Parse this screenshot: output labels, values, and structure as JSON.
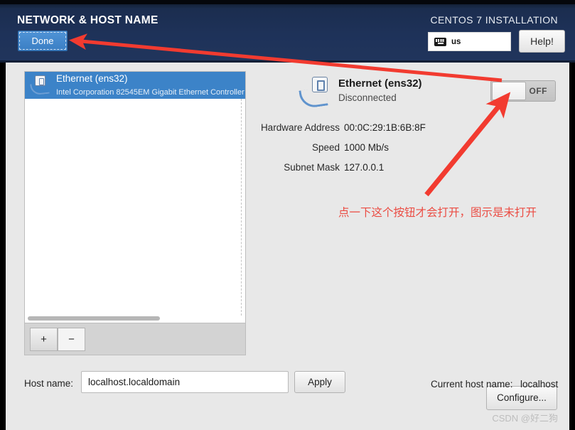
{
  "header": {
    "page_title": "NETWORK & HOST NAME",
    "done_label": "Done",
    "install_title": "CENTOS 7 INSTALLATION",
    "keyboard_layout": "us",
    "help_label": "Help!"
  },
  "device_list": {
    "items": [
      {
        "name": "Ethernet (ens32)",
        "description": "Intel Corporation 82545EM Gigabit Ethernet Controller (",
        "selected": true,
        "icon": "ethernet-icon"
      }
    ],
    "add_label": "+",
    "remove_label": "−"
  },
  "detail": {
    "icon": "ethernet-icon",
    "name": "Ethernet (ens32)",
    "status": "Disconnected",
    "toggle_state": "OFF",
    "rows": [
      {
        "label": "Hardware Address",
        "value": "00:0C:29:1B:6B:8F"
      },
      {
        "label": "Speed",
        "value": "1000 Mb/s"
      },
      {
        "label": "Subnet Mask",
        "value": "127.0.0.1"
      }
    ],
    "configure_label": "Configure..."
  },
  "hostname": {
    "label": "Host name:",
    "value": "localhost.localdomain",
    "placeholder": "localhost.localdomain",
    "apply_label": "Apply",
    "current_label": "Current host name:",
    "current_value": "localhost"
  },
  "annotation": {
    "text": "点一下这个按钮才会打开，图示是未打开",
    "color": "#eb4b42"
  },
  "watermark": "CSDN @好二狗",
  "colors": {
    "header_navy": "#1e3259",
    "accent_blue": "#3c83c8",
    "body_gray": "#e8e8e8",
    "annotation_red": "#eb4b42"
  }
}
